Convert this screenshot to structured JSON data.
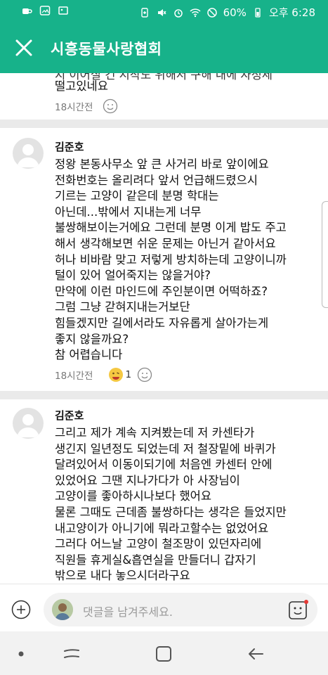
{
  "status_bar": {
    "battery": "60%",
    "time": "오후 6:28",
    "icons_left": [
      "cup-icon",
      "gallery-icon",
      "image-icon"
    ],
    "icons_right": [
      "battery-saver-icon",
      "mute-icon",
      "alarm-icon",
      "wifi-icon",
      "block-icon",
      "battery-icon"
    ]
  },
  "app_bar": {
    "title": "시흥동물사랑협회",
    "close_icon": "close-icon"
  },
  "partial_comment": {
    "text_line_cut": "지 이어질 건 시작도 위해서 구해 내에 자정세",
    "text_line": "떨고있네요",
    "time": "18시간전"
  },
  "comments": [
    {
      "author": "김준호",
      "lines": [
        "정왕  본동사무소 앞 큰 사거리 바로 앞이에요",
        "전화번호는 올리려다 앞서 언급해드렸으시",
        "기르는 고양이 같은데 분명 학대는",
        "아닌데...밖에서 지내는게 너무",
        "불쌍해보이는거에요 그런데 분명 이게 밥도 주고",
        "해서 생각해보면 쉬운 문제는 아닌거 같아서요",
        "허나 비바람 맞고 저렇게 방치하는데 고양이니까",
        "털이 있어 얼어죽지는 않을거야?",
        "만약에 이런 마인드에 주인분이면 어떡하죠?",
        "그럼 그냥 갇혀지내는거보단",
        "힘들겠지만 길에서라도 자유롭게 살아가는게",
        "좋지 않을까요?",
        "참 어렵습니다"
      ],
      "time": "18시간전",
      "reaction_count": "1"
    },
    {
      "author": "김준호",
      "lines": [
        "그리고 제가 계속 지켜봤는데 저 카센타가",
        "생긴지 일년정도 되었는데 저 철장밑에 바퀴가",
        "달려있어서 이동이되기에 처음엔 카센터 안에",
        "있었어요 그땐 지나가다가 아 사장님이",
        "고양이를 좋아하시나보다 했어요",
        "물론 그때도 근데좀 불쌍하다는 생각은 들었지만",
        "내고양이가 아니기에 뭐라고할수는 없었어요",
        "그러다 어느날 고양이 철조망이 있던자리에",
        "직원들 휴게실&흡연실을 만들더니 갑자기",
        "밖으로 내다 놓으시더라구요"
      ]
    }
  ],
  "input": {
    "placeholder": "댓글을 남겨주세요."
  },
  "nav": {
    "buttons": [
      "dot-icon",
      "recents-icon",
      "home-icon",
      "back-icon"
    ]
  },
  "colors": {
    "brand_green": "#17b28a"
  }
}
